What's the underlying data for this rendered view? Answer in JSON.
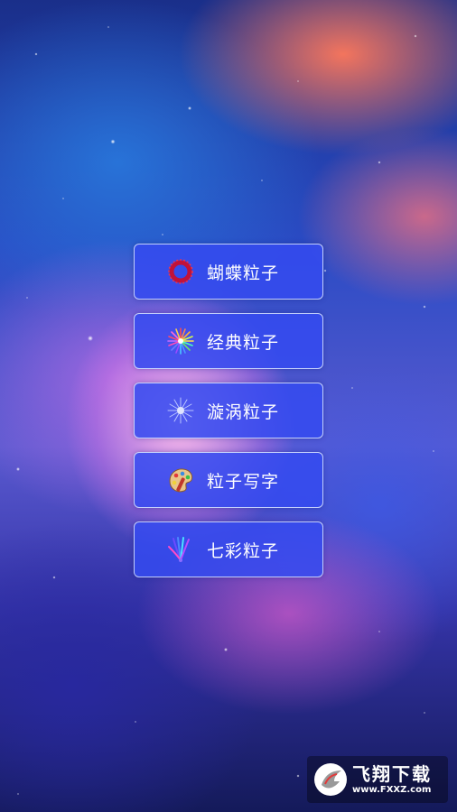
{
  "menu": {
    "items": [
      {
        "label": "蝴蝶粒子",
        "icon": "butterfly-particle-icon"
      },
      {
        "label": "经典粒子",
        "icon": "classic-particle-icon"
      },
      {
        "label": "漩涡粒子",
        "icon": "vortex-particle-icon"
      },
      {
        "label": "粒子写字",
        "icon": "palette-icon"
      },
      {
        "label": "七彩粒子",
        "icon": "rainbow-particle-icon"
      }
    ]
  },
  "watermark": {
    "title": "飞翔下载",
    "url": "www.FXXZ.com"
  },
  "colors": {
    "button_fill": "#344af0",
    "button_border": "#dce6ff",
    "text": "#ffffff"
  }
}
